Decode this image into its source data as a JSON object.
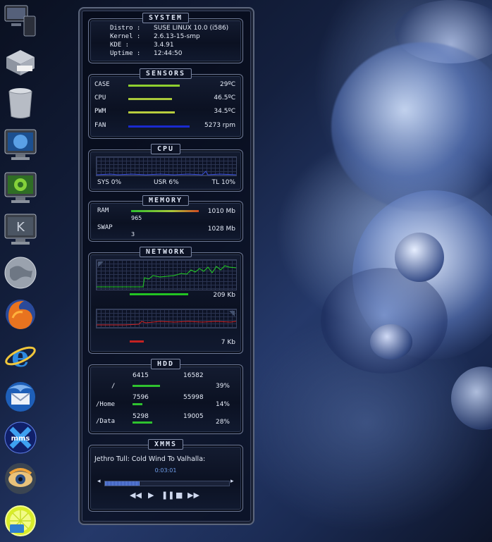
{
  "system": {
    "title": "SYSTEM",
    "rows": [
      {
        "label": "Distro :",
        "value": "SUSE LINUX 10.0 (i586)"
      },
      {
        "label": "Kernel :",
        "value": "2.6.13-15-smp"
      },
      {
        "label": "KDE :",
        "value": "3.4.91"
      },
      {
        "label": "Uptime :",
        "value": "12:44:50"
      }
    ]
  },
  "sensors": {
    "title": "SENSORS",
    "rows": [
      {
        "label": "CASE",
        "value": "29ºC",
        "level": 0.55,
        "color": "#8fcf2f"
      },
      {
        "label": "CPU",
        "value": "46.5ºC",
        "level": 0.47,
        "color": "#a9c93a"
      },
      {
        "label": "PWM",
        "value": "34.5ºC",
        "level": 0.5,
        "color": "#b7cc3d"
      },
      {
        "label": "FAN",
        "value": "5273 rpm",
        "level": 0.66,
        "color": "#1a2ad0"
      }
    ]
  },
  "cpu": {
    "title": "CPU",
    "sys": "SYS 0%",
    "usr": "USR 6%",
    "tl": "TL 10%"
  },
  "memory": {
    "title": "MEMORY",
    "ram_label": "RAM",
    "ram_used": "965",
    "ram_total": "1010 Mb",
    "ram_level": 0.96,
    "swap_label": "SWAP",
    "swap_used": "3",
    "swap_total": "1028 Mb"
  },
  "network": {
    "title": "NETWORK",
    "down_value": "209 Kb",
    "up_value": "7 Kb",
    "down_level": 0.65,
    "up_level": 0.16,
    "down_color": "#22c422",
    "up_color": "#c42222"
  },
  "hdd": {
    "title": "HDD",
    "rows": [
      {
        "mount": "/",
        "used": "6415",
        "total": "16582",
        "pct": "39%",
        "level": 0.39
      },
      {
        "mount": "/Home",
        "used": "7596",
        "total": "55998",
        "pct": "14%",
        "level": 0.14
      },
      {
        "mount": "/Data",
        "used": "5298",
        "total": "19005",
        "pct": "28%",
        "level": 0.28
      }
    ]
  },
  "xmms": {
    "title": "XMMS",
    "track": "Jethro Tull: Cold Wind To Valhalla:",
    "time": "0:03:01",
    "progress": 0.28
  },
  "dock": {
    "icons": [
      "computer-icon",
      "printer-icon",
      "trash-icon",
      "network-monitor-icon",
      "suse-monitor-icon",
      "kde-monitor-icon",
      "globe-icon",
      "firefox-icon",
      "internet-explorer-icon",
      "thunderbird-icon",
      "msn-icon",
      "eye-app-icon",
      "lime-icon"
    ]
  }
}
